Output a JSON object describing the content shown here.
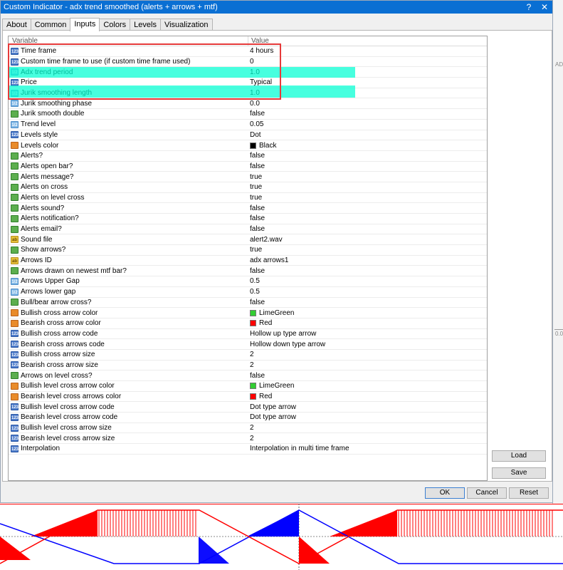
{
  "window": {
    "title": "Custom Indicator - adx trend smoothed (alerts + arrows + mtf)",
    "help_glyph": "?",
    "close_glyph": "✕"
  },
  "tabs": [
    {
      "label": "About"
    },
    {
      "label": "Common"
    },
    {
      "label": "Inputs"
    },
    {
      "label": "Colors"
    },
    {
      "label": "Levels"
    },
    {
      "label": "Visualization"
    }
  ],
  "grid": {
    "headers": {
      "variable": "Variable",
      "value": "Value"
    },
    "rows": [
      {
        "icon": "num",
        "variable": "Time frame",
        "value": "4 hours"
      },
      {
        "icon": "num",
        "variable": "Custom time frame to use (if custom time frame used)",
        "value": "0"
      },
      {
        "icon": "dbl",
        "variable": "Adx trend period",
        "value": "1.0"
      },
      {
        "icon": "num",
        "variable": "Price",
        "value": "Typical"
      },
      {
        "icon": "dbl",
        "variable": "Jurik smoothing length",
        "value": "1.0"
      },
      {
        "icon": "dbl",
        "variable": "Jurik smoothing phase",
        "value": "0.0"
      },
      {
        "icon": "bool",
        "variable": "Jurik smooth double",
        "value": "false"
      },
      {
        "icon": "dbl",
        "variable": "Trend level",
        "value": "0.05"
      },
      {
        "icon": "num",
        "variable": "Levels style",
        "value": "Dot"
      },
      {
        "icon": "col",
        "variable": "Levels color",
        "value": "Black",
        "swatch": "#000000"
      },
      {
        "icon": "bool",
        "variable": "Alerts?",
        "value": "false"
      },
      {
        "icon": "bool",
        "variable": "Alerts open bar?",
        "value": "false"
      },
      {
        "icon": "bool",
        "variable": "Alerts message?",
        "value": "true"
      },
      {
        "icon": "bool",
        "variable": "Alerts on cross",
        "value": "true"
      },
      {
        "icon": "bool",
        "variable": "Alerts on level cross",
        "value": "true"
      },
      {
        "icon": "bool",
        "variable": "Alerts sound?",
        "value": "false"
      },
      {
        "icon": "bool",
        "variable": "Alerts notification?",
        "value": "false"
      },
      {
        "icon": "bool",
        "variable": "Alerts email?",
        "value": "false"
      },
      {
        "icon": "str",
        "variable": "Sound file",
        "value": "alert2.wav"
      },
      {
        "icon": "bool",
        "variable": "Show arrows?",
        "value": "true"
      },
      {
        "icon": "str",
        "variable": "Arrows ID",
        "value": "adx arrows1"
      },
      {
        "icon": "bool",
        "variable": "Arrows drawn on newest mtf bar?",
        "value": "false"
      },
      {
        "icon": "dbl",
        "variable": "Arrows Upper Gap",
        "value": "0.5"
      },
      {
        "icon": "dbl",
        "variable": "Arrows lower gap",
        "value": "0.5"
      },
      {
        "icon": "bool",
        "variable": "Bull/bear arrow cross?",
        "value": "false"
      },
      {
        "icon": "col",
        "variable": "Bullish cross arrow color",
        "value": "LimeGreen",
        "swatch": "#32cd32"
      },
      {
        "icon": "col",
        "variable": "Bearish cross arrow color",
        "value": "Red",
        "swatch": "#ff0000"
      },
      {
        "icon": "num",
        "variable": "Bullish cross arrow code",
        "value": "Hollow up type arrow"
      },
      {
        "icon": "num",
        "variable": "Bearish cross arrows code",
        "value": "Hollow down type arrow"
      },
      {
        "icon": "num",
        "variable": "Bullish cross arrow size",
        "value": "2"
      },
      {
        "icon": "num",
        "variable": "Bearish cross arrow size",
        "value": "2"
      },
      {
        "icon": "bool",
        "variable": "Arrows on level cross?",
        "value": "false"
      },
      {
        "icon": "col",
        "variable": "Bullish level cross arrow color",
        "value": "LimeGreen",
        "swatch": "#32cd32"
      },
      {
        "icon": "col",
        "variable": "Bearish level cross arrows color",
        "value": "Red",
        "swatch": "#ff0000"
      },
      {
        "icon": "num",
        "variable": "Bullish level cross arrow code",
        "value": "Dot type arrow"
      },
      {
        "icon": "num",
        "variable": "Bearish level cross arrow code",
        "value": "Dot type arrow"
      },
      {
        "icon": "num",
        "variable": "Bullish level cross arrow size",
        "value": "2"
      },
      {
        "icon": "num",
        "variable": "Bearish level cross arrow size",
        "value": "2"
      },
      {
        "icon": "num",
        "variable": "Interpolation",
        "value": "Interpolation in multi time frame"
      }
    ]
  },
  "buttons": {
    "load": "Load",
    "save": "Save",
    "ok": "OK",
    "cancel": "Cancel",
    "reset": "Reset"
  },
  "icons": {
    "num": "123",
    "dbl": "1/2",
    "bool": "",
    "str": "ab",
    "col": ""
  },
  "side_text": {
    "adr": "ADR",
    "val": "0.0"
  },
  "colors": {
    "titlebar": "#0a6fd3",
    "highlight": "#00ffd2",
    "annotation_box": "#e63a3a",
    "chart_red": "#ff0000",
    "chart_blue": "#0000ff"
  }
}
